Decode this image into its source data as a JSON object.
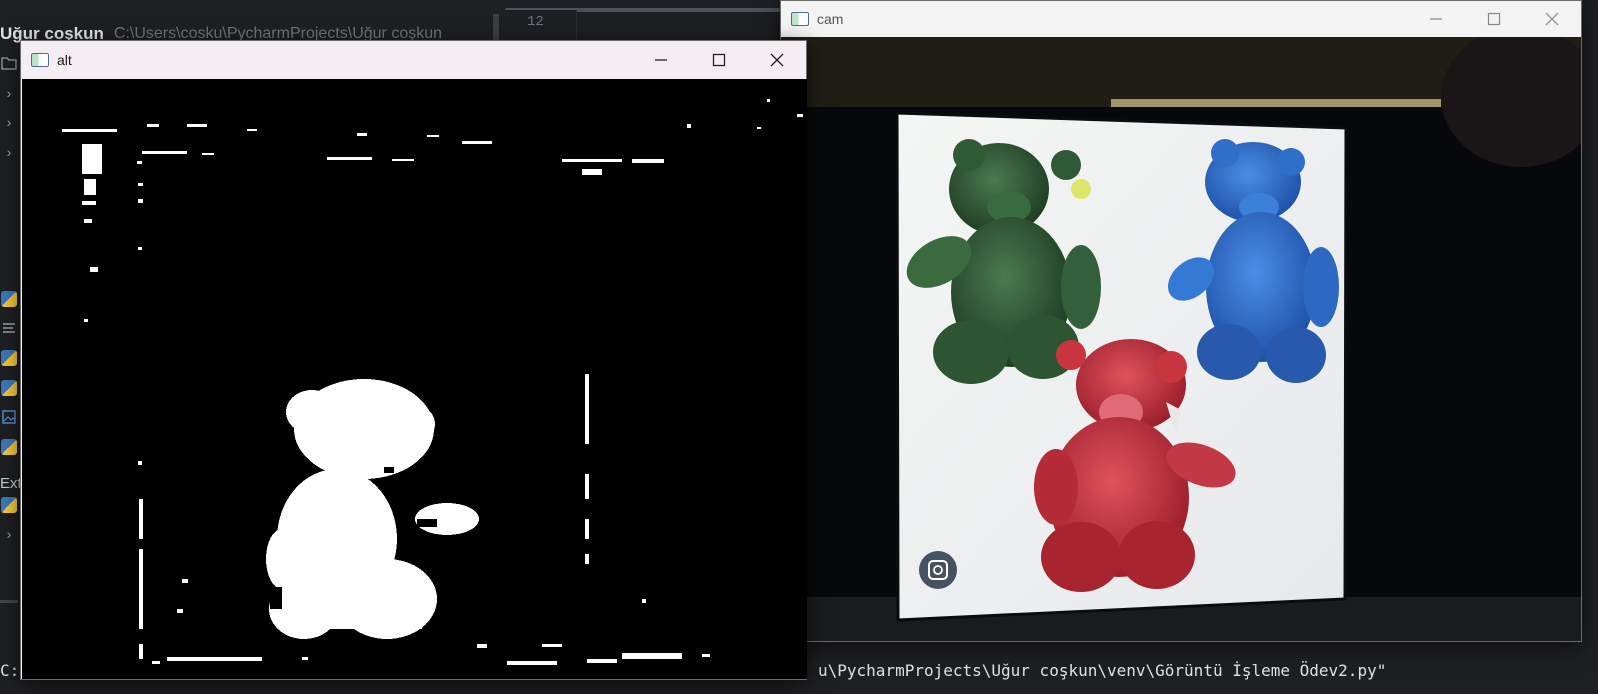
{
  "ide": {
    "project_name": "Uğur coşkun",
    "project_path": "C:\\Users\\cosku\\PycharmProjects\\Uğur coşkun",
    "line_number": "12",
    "ext_label": "Ext",
    "terminal_left": "C:\\",
    "terminal_right": "u\\PycharmProjects\\Uğur coşkun\\venv\\Görüntü İşleme Ödev2.py\"",
    "strip_icons": [
      "folder-icon",
      "chevron-right-icon",
      "chevron-right-icon",
      "chevron-right-icon",
      "python-file-icon",
      "text-file-icon",
      "python-file-icon",
      "python-file-icon",
      "image-file-icon",
      "python-file-icon",
      "python-file-icon",
      "chevron-right-icon"
    ]
  },
  "windows": {
    "alt": {
      "title": "alt",
      "content": "binary-mask-image",
      "controls": [
        "minimize",
        "maximize",
        "close"
      ]
    },
    "cam": {
      "title": "cam",
      "content": "camera-feed-three-teddy-bears",
      "controls": [
        "minimize",
        "maximize",
        "close"
      ]
    }
  },
  "colors": {
    "ide_bg": "#1e1f22",
    "mask_fg": "#ffffff",
    "mask_bg": "#000000",
    "bear_green": "#2f5a34",
    "bear_blue": "#2f6fc9",
    "bear_red": "#c8353f"
  }
}
